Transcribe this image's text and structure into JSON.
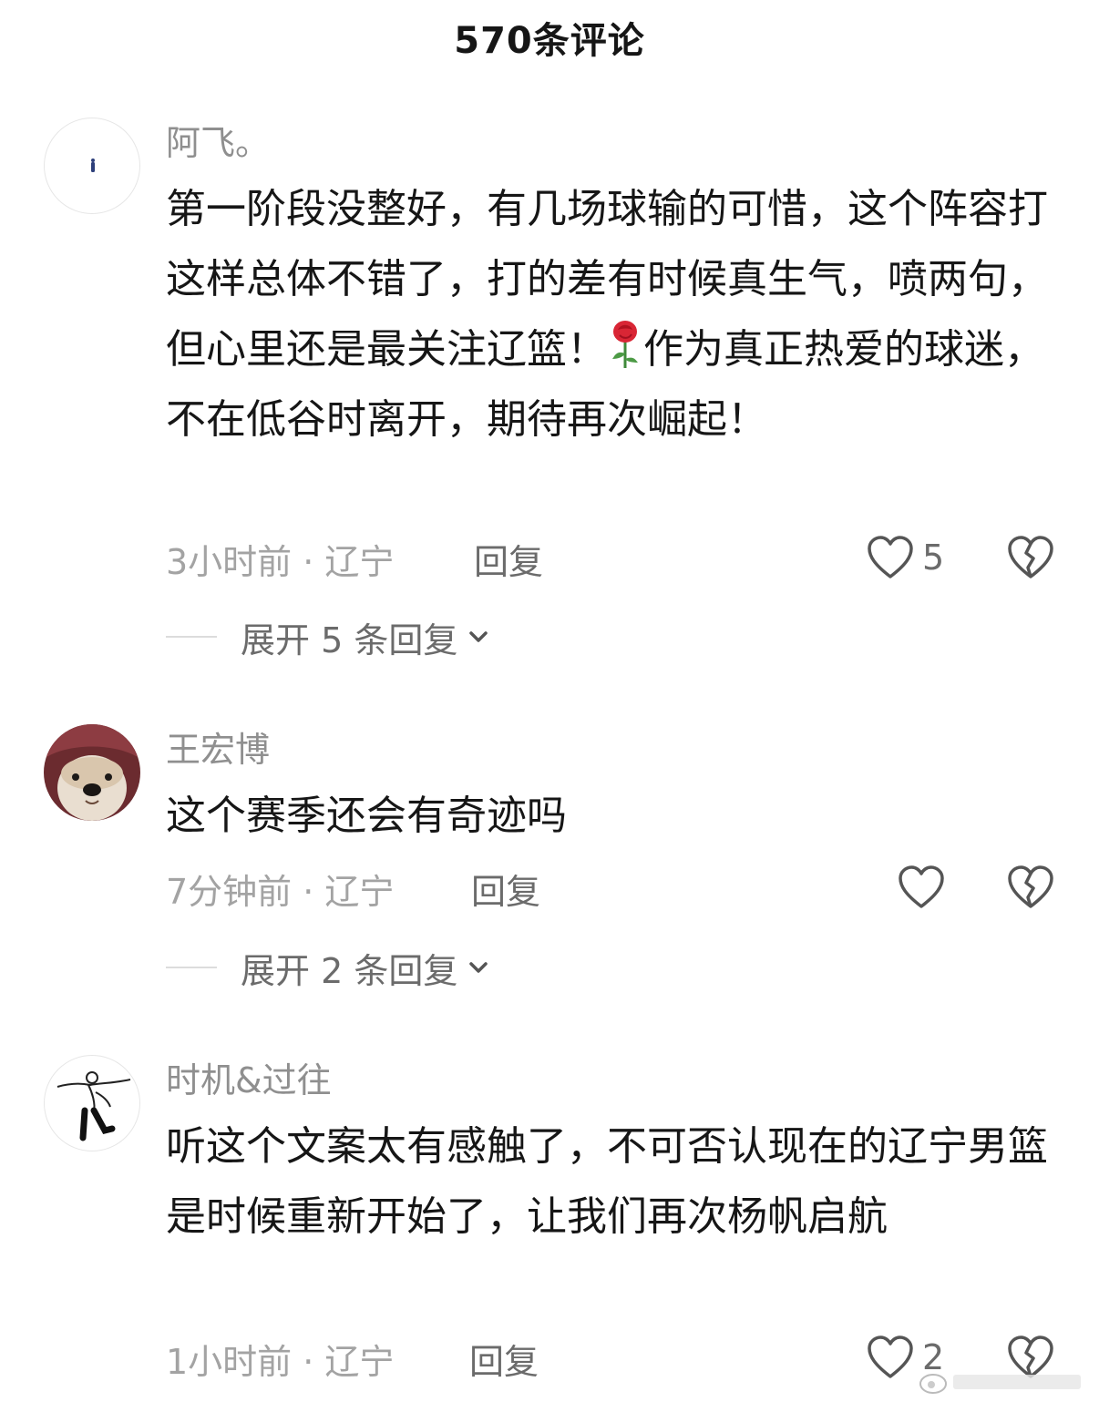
{
  "header": {
    "title": "570条评论"
  },
  "comments": [
    {
      "username": "阿飞。",
      "text_before_emoji": "第一阶段没整好，有几场球输的可惜，这个阵容打这样总体不错了，打的差有时候真生气，喷两句，但心里还是最关注辽篮！",
      "emoji_icon": "rose-emoji",
      "text_after_emoji": "作为真正热爱的球迷，不在低谷时离开，期待再次崛起！",
      "time_location": "3小时前 · 辽宁",
      "reply_label": "回复",
      "like_count": "5",
      "expand_label": "展开 5 条回复"
    },
    {
      "username": "王宏博",
      "text": "这个赛季还会有奇迹吗",
      "time_location": "7分钟前 · 辽宁",
      "reply_label": "回复",
      "like_count": "",
      "expand_label": "展开 2 条回复"
    },
    {
      "username": "时机&过往",
      "text": "听这个文案太有感触了，不可否认现在的辽宁男篮是时候重新开始了，让我们再次杨帆启航",
      "time_location": "1小时前 · 辽宁",
      "reply_label": "回复",
      "like_count": "2"
    }
  ],
  "icons": {
    "like": "heart-outline-icon",
    "dislike": "broken-heart-icon",
    "expand": "chevron-down-icon"
  },
  "colors": {
    "text_primary": "#161616",
    "username": "#8f8f8f",
    "meta": "#a3a3a3",
    "secondary": "#6b6b6b"
  }
}
